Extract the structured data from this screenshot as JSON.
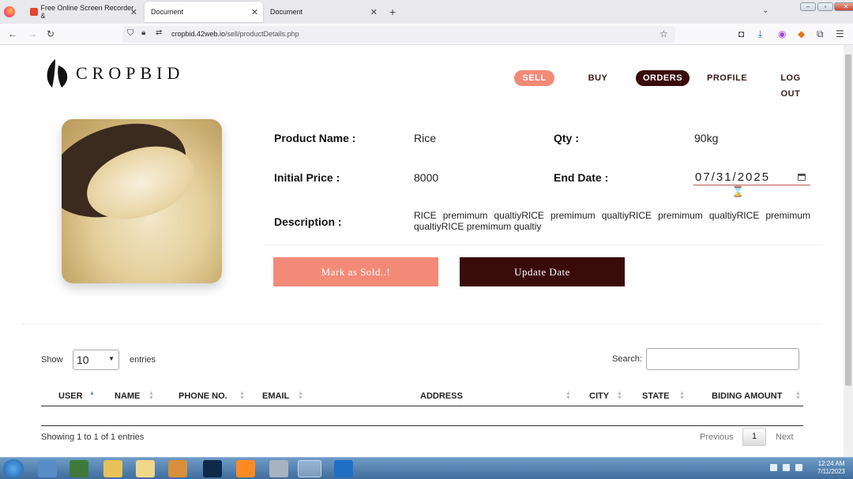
{
  "browser": {
    "tabs": [
      {
        "title": "Free Online Screen Recorder & "
      },
      {
        "title": "Document"
      },
      {
        "title": "Document"
      }
    ],
    "new_tab": "+",
    "url_host": "cropbid.42web.io",
    "url_path": "/sell/productDetails.php"
  },
  "header": {
    "logo_text": "CROPBID",
    "nav": [
      "SELL",
      "BUY",
      "ORDERS",
      "PROFILE",
      "LOG OUT"
    ]
  },
  "product": {
    "name_label": "Product Name :",
    "name": "Rice",
    "qty_label": "Qty :",
    "qty": "90kg",
    "price_label": "Initial Price :",
    "price": "8000",
    "end_date_label": "End Date :",
    "end_date": "07/31/2025",
    "description_label": "Description :",
    "description": "RICE premimum qualtiyRICE premimum qualtiyRICE premimum qualtiyRICE premimum qualtiyRICE premimum qualtiy"
  },
  "actions": {
    "mark_sold": "Mark as Sold..!",
    "update_date": "Update Date"
  },
  "table": {
    "show_label": "Show",
    "entries_value": "10",
    "entries_label": "entries",
    "search_label": "Search:",
    "search_value": "",
    "columns": [
      "USER",
      "NAME",
      "PHONE NO.",
      "EMAIL",
      "ADDRESS",
      "CITY",
      "STATE",
      "BIDING AMOUNT"
    ],
    "info": "Showing 1 to 1 of 1 entries",
    "previous": "Previous",
    "page": "1",
    "next": "Next"
  },
  "taskbar": {
    "time": "12:24 AM",
    "date": "7/11/2023"
  },
  "colors": {
    "accent_salmon": "#f38a78",
    "accent_maroon": "#3a0b0b"
  }
}
